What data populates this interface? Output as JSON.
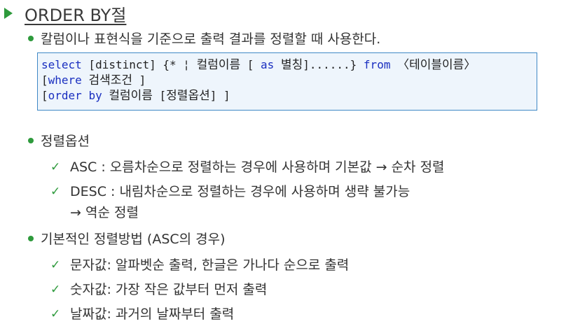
{
  "title": "ORDER BY절",
  "intro_bullet": "칼럼이나 표현식을 기준으로 출력 결과를 정렬할 때 사용한다.",
  "code": {
    "line1": {
      "select": "select",
      "p1": " [distinct] {* ¦ ",
      "col": "컬럼이름",
      "p2": " [ ",
      "as": "as",
      "p3": " ",
      "alias": "별칭",
      "p4": "]......} ",
      "from": "from",
      "p5": " ",
      "table": "〈테이블이름〉"
    },
    "line2": {
      "open": "[",
      "where": "where",
      "p1": " ",
      "cond": "검색조건",
      "close": " ]"
    },
    "line3": {
      "open": "[",
      "order_by": "order by",
      "p1": " ",
      "col": "컬럼이름",
      "p2": " [",
      "opt": "정렬옵션",
      "close": "] ]"
    }
  },
  "sort_options": {
    "heading": "정렬옵션",
    "asc": "ASC : 오름차순으로 정렬하는 경우에 사용하며 기본값 → 순차 정렬",
    "desc_line1": "DESC : 내림차순으로 정렬하는 경우에 사용하며 생략 불가능",
    "desc_line2": "→ 역순 정렬"
  },
  "basic_method": {
    "heading": "기본적인 정렬방법 (ASC의 경우)",
    "items": [
      "문자값: 알파벳순 출력, 한글은 가나다 순으로 출력",
      "숫자값: 가장 작은 값부터 먼저 출력",
      "날짜값: 과거의 날짜부터 출력"
    ]
  },
  "colors": {
    "accent_green": "#2e9a3c",
    "code_border": "#3f88c5",
    "code_bg": "#eef5fc",
    "keyword_blue": "#1a2fc0"
  },
  "icons": {
    "title_marker": "triangle-right-icon",
    "bullet_marker": "green-dot-icon",
    "check_marker": "check-mark-icon"
  }
}
